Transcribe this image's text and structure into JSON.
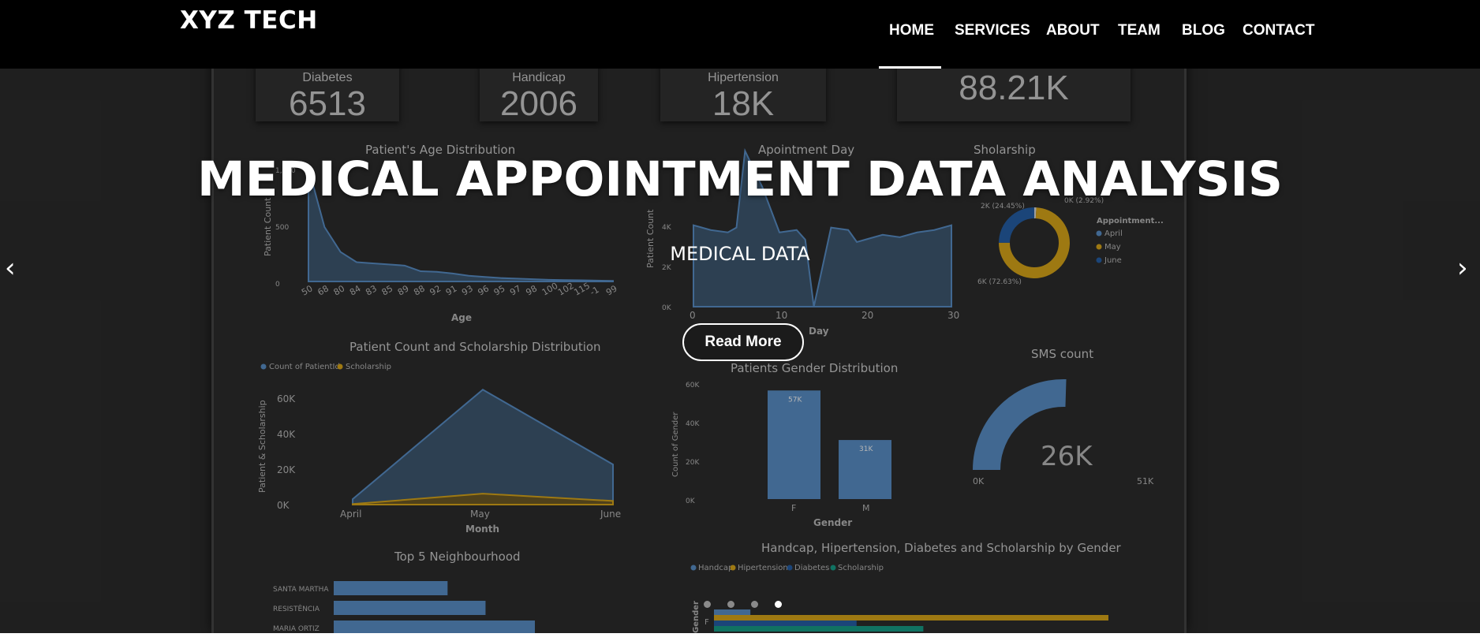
{
  "nav": {
    "logo": "XYZ TECH",
    "items": [
      "HOME",
      "SERVICES",
      "ABOUT",
      "TEAM",
      "BLOG",
      "CONTACT"
    ],
    "active": "HOME"
  },
  "hero": {
    "title": "MEDICAL APPOINTMENT DATA ANALYSIS",
    "subtitle": "MEDICAL DATA",
    "button": "Read More",
    "slide_count": 4,
    "active_slide": 4,
    "prev_icon": "chevron-left-icon",
    "next_icon": "chevron-right-icon"
  },
  "dashboard": {
    "kpis": [
      {
        "label": "Diabetes",
        "value": "6513"
      },
      {
        "label": "Handicap",
        "value": "2006"
      },
      {
        "label": "Hipertension",
        "value": "18K"
      },
      {
        "label": "",
        "value": "88.21K"
      }
    ],
    "colors": {
      "blue": "#4a77a6",
      "gold": "#b48a15",
      "darkblue": "#1f4f8a",
      "teal": "#138270"
    }
  },
  "chart_data": [
    {
      "type": "area",
      "title": "Patient's Age Distribution",
      "xlabel": "Age",
      "ylabel": "Patient Count",
      "categories": [
        "50",
        "68",
        "80",
        "84",
        "83",
        "85",
        "89",
        "88",
        "92",
        "91",
        "93",
        "96",
        "95",
        "97",
        "98",
        "100",
        "102",
        "115",
        "-1",
        "99"
      ],
      "values": [
        1000,
        480,
        260,
        170,
        160,
        150,
        140,
        90,
        85,
        70,
        50,
        40,
        30,
        25,
        20,
        15,
        12,
        10,
        8,
        5
      ],
      "yticks": [
        "1,000",
        "500",
        "0"
      ],
      "ylim": [
        0,
        1000
      ]
    },
    {
      "type": "area",
      "title": "Apointment Day",
      "xlabel": "Day",
      "ylabel": "Patient Count",
      "x": [
        0,
        2,
        4,
        5,
        6,
        8,
        10,
        12,
        13,
        14,
        16,
        18,
        19,
        20,
        22,
        24,
        26,
        28,
        30
      ],
      "values": [
        3400,
        3200,
        3100,
        3300,
        6500,
        5000,
        3100,
        3200,
        2800,
        0,
        3300,
        3200,
        2700,
        2800,
        3000,
        2900,
        3100,
        3200,
        3400
      ],
      "yticks": [
        "4K",
        "2K",
        "0K"
      ],
      "xticks": [
        "0",
        "10",
        "20",
        "30"
      ],
      "ylim": [
        0,
        5000
      ]
    },
    {
      "type": "pie",
      "title": "Sholarship",
      "legend_title": "Appointment...",
      "labels": [
        "April",
        "May",
        "June"
      ],
      "values": [
        0.92,
        72.63,
        24.45
      ],
      "slice_labels": [
        "0K (2.92%)",
        "6K (72.63%)",
        "2K (24.45%)"
      ],
      "colors": [
        "#b4b4b4",
        "#b48a15",
        "#1f4f8a"
      ]
    },
    {
      "type": "area",
      "title": "Patient Count and Scholarship Distribution",
      "xlabel": "Month",
      "ylabel": "Patient & Scholarship",
      "categories": [
        "April",
        "May",
        "June"
      ],
      "series": [
        {
          "name": "Count of PatientId",
          "values": [
            3000,
            63000,
            22000
          ]
        },
        {
          "name": "Scholarship",
          "values": [
            300,
            6000,
            2000
          ]
        }
      ],
      "yticks": [
        "60K",
        "40K",
        "20K",
        "0K"
      ],
      "ylim": [
        0,
        70000
      ]
    },
    {
      "type": "bar",
      "title": "Patients Gender Distribution",
      "xlabel": "Gender",
      "ylabel": "Count of Gender",
      "categories": [
        "F",
        "M"
      ],
      "values": [
        57000,
        31000
      ],
      "data_labels": [
        "57K",
        "31K"
      ],
      "yticks": [
        "60K",
        "40K",
        "20K",
        "0K"
      ],
      "ylim": [
        0,
        60000
      ]
    },
    {
      "type": "gauge",
      "title": "SMS count",
      "value": 26000,
      "value_label": "26K",
      "min_label": "0K",
      "max_label": "51K",
      "max": 51000
    },
    {
      "type": "bar",
      "title": "Top 5 Neighbourhood",
      "categories": [
        "SANTA MARTHA",
        "RESISTÊNCIA",
        "MARIA ORTIZ"
      ],
      "values": [
        3000,
        4000,
        5300
      ]
    },
    {
      "type": "bar",
      "title": "Handcap, Hipertension, Diabetes and Scholarship by Gender",
      "legend": [
        "Handcap",
        "Hipertension",
        "Diabetes",
        "Scholarship"
      ],
      "ylabel": "Gender",
      "categories": [
        "F"
      ],
      "series": [
        {
          "name": "Handcap",
          "values": [
            1200
          ]
        },
        {
          "name": "Hipertension",
          "values": [
            13000
          ]
        },
        {
          "name": "Diabetes",
          "values": [
            4700
          ]
        },
        {
          "name": "Scholarship",
          "values": [
            6900
          ]
        }
      ]
    }
  ]
}
